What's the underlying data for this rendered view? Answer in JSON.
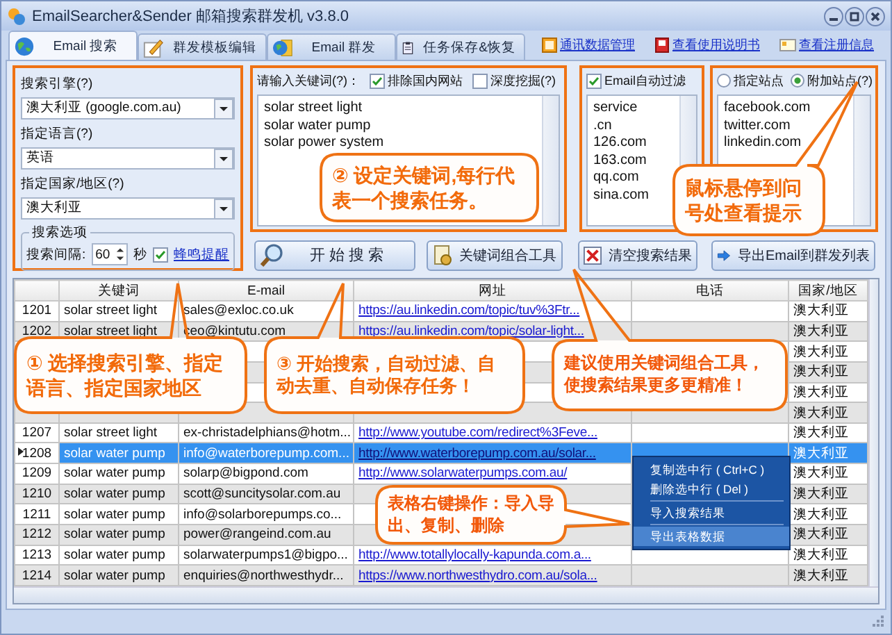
{
  "window": {
    "title": "EmailSearcher&Sender 邮箱搜索群发机 v3.8.0"
  },
  "tabs": [
    {
      "label": "Email 搜索",
      "selected": true
    },
    {
      "label": "群发模板编辑",
      "selected": false
    },
    {
      "label": "Email 群发",
      "selected": false
    },
    {
      "label": "任务保存&恢复",
      "selected": false
    }
  ],
  "links": [
    "通讯数据管理",
    "查看使用说明书",
    "查看注册信息"
  ],
  "search_panel": {
    "engine_label": "搜索引擎(?)",
    "engine": "澳大利亚 (google.com.au)",
    "language_label": "指定语言(?)",
    "language": "英语",
    "country_label": "指定国家/地区(?)",
    "country": "澳大利亚",
    "options_title": "搜索选项",
    "interval_label": "搜索间隔:",
    "interval": "60",
    "interval_unit": "秒",
    "beep": {
      "label": "蜂鸣提醒",
      "checked": true
    }
  },
  "keywords": {
    "label": "请输入关键词(?)：",
    "exclude_domestic": {
      "label": "排除国内网站",
      "checked": true
    },
    "deep_mining": {
      "label": "深度挖掘(?)",
      "checked": false
    },
    "lines": [
      "solar street light",
      "solar water pump",
      "solar power system"
    ]
  },
  "email_filter": {
    "label": "Email自动过滤",
    "checked": true,
    "lines": [
      "service",
      ".cn",
      "126.com",
      "163.com",
      "qq.com",
      "sina.com"
    ]
  },
  "sites": {
    "options": [
      {
        "label": "指定站点",
        "selected": false
      },
      {
        "label": "附加站点(?)",
        "selected": true
      }
    ],
    "lines": [
      "facebook.com",
      "twitter.com",
      "linkedin.com"
    ]
  },
  "buttons": [
    "开 始 搜 索",
    "关键词组合工具",
    "清空搜索结果",
    "导出Email到群发列表"
  ],
  "table": {
    "columns": [
      "关键词",
      "E-mail",
      "网址",
      "电话",
      "国家/地区"
    ],
    "rows": [
      {
        "index": "1201",
        "keyword": "solar street light",
        "email": "sales@exloc.co.uk",
        "url": "https://au.linkedin.com/topic/tuv%3Ftr...",
        "country": "澳大利亚",
        "selected": false
      },
      {
        "index": "1202",
        "keyword": "solar street light",
        "email": "ceo@kintutu.com",
        "url": "https://au.linkedin.com/topic/solar-light...",
        "country": "澳大利亚",
        "selected": false
      },
      {
        "country": "澳大利亚",
        "selected": false
      },
      {
        "country": "澳大利亚",
        "selected": false
      },
      {
        "country": "澳大利亚",
        "selected": false
      },
      {
        "country": "澳大利亚",
        "selected": false
      },
      {
        "index": "1207",
        "keyword": "solar street light",
        "email": "ex-christadelphians@hotm...",
        "url": "http://www.youtube.com/redirect%3Feve...",
        "country": "澳大利亚",
        "selected": false
      },
      {
        "index": "1208",
        "keyword": "solar water pump",
        "email": "info@waterborepump.com...",
        "url": "http://www.waterborepump.com.au/solar...",
        "country": "澳大利亚",
        "selected": true
      },
      {
        "index": "1209",
        "keyword": "solar water pump",
        "email": "solarp@bigpond.com",
        "url": "http://www.solarwaterpumps.com.au/",
        "country": "澳大利亚",
        "selected": false
      },
      {
        "index": "1210",
        "keyword": "solar water pump",
        "email": "scott@suncitysolar.com.au",
        "country": "澳大利亚",
        "selected": false
      },
      {
        "index": "1211",
        "keyword": "solar water pump",
        "email": "info@solarborepumps.co...",
        "country": "澳大利亚",
        "selected": false
      },
      {
        "index": "1212",
        "keyword": "solar water pump",
        "email": "power@rangeind.com.au",
        "country": "澳大利亚",
        "selected": false
      },
      {
        "index": "1213",
        "keyword": "solar water pump",
        "email": "solarwaterpumps1@bigpo...",
        "url": "http://www.totallylocally-kapunda.com.a...",
        "country": "澳大利亚",
        "selected": false
      },
      {
        "index": "1214",
        "keyword": "solar water pump",
        "email": "enquiries@northwesthydr...",
        "url": "https://www.northwesthydro.com.au/sola...",
        "country": "澳大利亚",
        "selected": false
      }
    ]
  },
  "context_menu": {
    "items": [
      {
        "label": "复制选中行 ( Ctrl+C )",
        "selected": false
      },
      {
        "label": "删除选中行 ( Del )",
        "selected": false
      },
      {
        "label": "导入搜索结果",
        "selected": false
      },
      {
        "label": "导出表格数据",
        "selected": true
      }
    ]
  },
  "callouts": [
    "② 设定关键词,每行代表一个搜索任务。",
    "鼠标悬停到问号处查看提示",
    "① 选择搜索引擎、指定语言、指定国家地区",
    "③ 开始搜索，自动过滤、自动去重、自动保存任务！",
    "建议使用关键词组合工具，使搜索结果更多更精准！",
    "表格右键操作：导入导出、复制、删除"
  ]
}
